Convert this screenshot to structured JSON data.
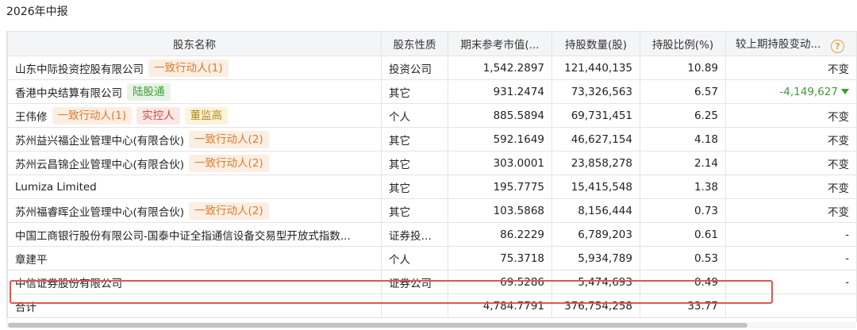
{
  "page_title": "2026年中报",
  "columns": [
    "股东名称",
    "股东性质",
    "期末参考市值(...",
    "持股数量(股)",
    "持股比例(%)",
    "较上期持股变动..."
  ],
  "help_icon_glyph": "?",
  "rows": [
    {
      "name": "山东中际投资控股有限公司",
      "tags": [
        {
          "text": "一致行动人(1)",
          "color": "orange"
        }
      ],
      "nature": "投资公司",
      "value": "1,542.2897",
      "shares": "121,440,135",
      "ratio": "10.89",
      "change": "不变",
      "change_dir": "none"
    },
    {
      "name": "香港中央结算有限公司",
      "tags": [
        {
          "text": "陆股通",
          "color": "green"
        }
      ],
      "nature": "其它",
      "value": "931.2474",
      "shares": "73,326,563",
      "ratio": "6.57",
      "change": "-4,149,627",
      "change_dir": "down"
    },
    {
      "name": "王伟修",
      "tags": [
        {
          "text": "一致行动人(1)",
          "color": "orange"
        },
        {
          "text": "实控人",
          "color": "red"
        },
        {
          "text": "董监高",
          "color": "yellow"
        }
      ],
      "nature": "个人",
      "value": "885.5894",
      "shares": "69,731,451",
      "ratio": "6.25",
      "change": "不变",
      "change_dir": "none"
    },
    {
      "name": "苏州益兴福企业管理中心(有限合伙)",
      "tags": [
        {
          "text": "一致行动人(2)",
          "color": "orange"
        }
      ],
      "nature": "其它",
      "value": "592.1649",
      "shares": "46,627,154",
      "ratio": "4.18",
      "change": "不变",
      "change_dir": "none"
    },
    {
      "name": "苏州云昌锦企业管理中心(有限合伙)",
      "tags": [
        {
          "text": "一致行动人(2)",
          "color": "orange"
        }
      ],
      "nature": "其它",
      "value": "303.0001",
      "shares": "23,858,278",
      "ratio": "2.14",
      "change": "不变",
      "change_dir": "none"
    },
    {
      "name": "Lumiza Limited",
      "tags": [],
      "nature": "其它",
      "value": "195.7775",
      "shares": "15,415,548",
      "ratio": "1.38",
      "change": "不变",
      "change_dir": "none"
    },
    {
      "name": "苏州福睿晖企业管理中心(有限合伙)",
      "tags": [
        {
          "text": "一致行动人(2)",
          "color": "orange"
        }
      ],
      "nature": "其它",
      "value": "103.5868",
      "shares": "8,156,444",
      "ratio": "0.73",
      "change": "不变",
      "change_dir": "none"
    },
    {
      "name": "中国工商银行股份有限公司-国泰中证全指通信设备交易型开放式指数...",
      "tags": [],
      "nature": "证券投资...",
      "value": "86.2229",
      "shares": "6,789,203",
      "ratio": "0.61",
      "change": "-",
      "change_dir": "none"
    },
    {
      "name": "章建平",
      "tags": [],
      "nature": "个人",
      "value": "75.3718",
      "shares": "5,934,789",
      "ratio": "0.53",
      "change": "-",
      "change_dir": "none"
    },
    {
      "name": "中信证券股份有限公司",
      "tags": [],
      "nature": "证券公司",
      "value": "69.5286",
      "shares": "5,474,693",
      "ratio": "0.49",
      "change": "-",
      "change_dir": "none"
    }
  ],
  "total": {
    "label": "合计",
    "value": "4,784.7791",
    "shares": "376,754,258",
    "ratio": "33.77"
  },
  "colors": {
    "highlight_border": "#e2554e",
    "tag_orange": "#e07c2a",
    "tag_green": "#3f9a38",
    "tag_red": "#d24b3e",
    "tag_yellow": "#b88a17",
    "change_down": "#3f9a38"
  }
}
